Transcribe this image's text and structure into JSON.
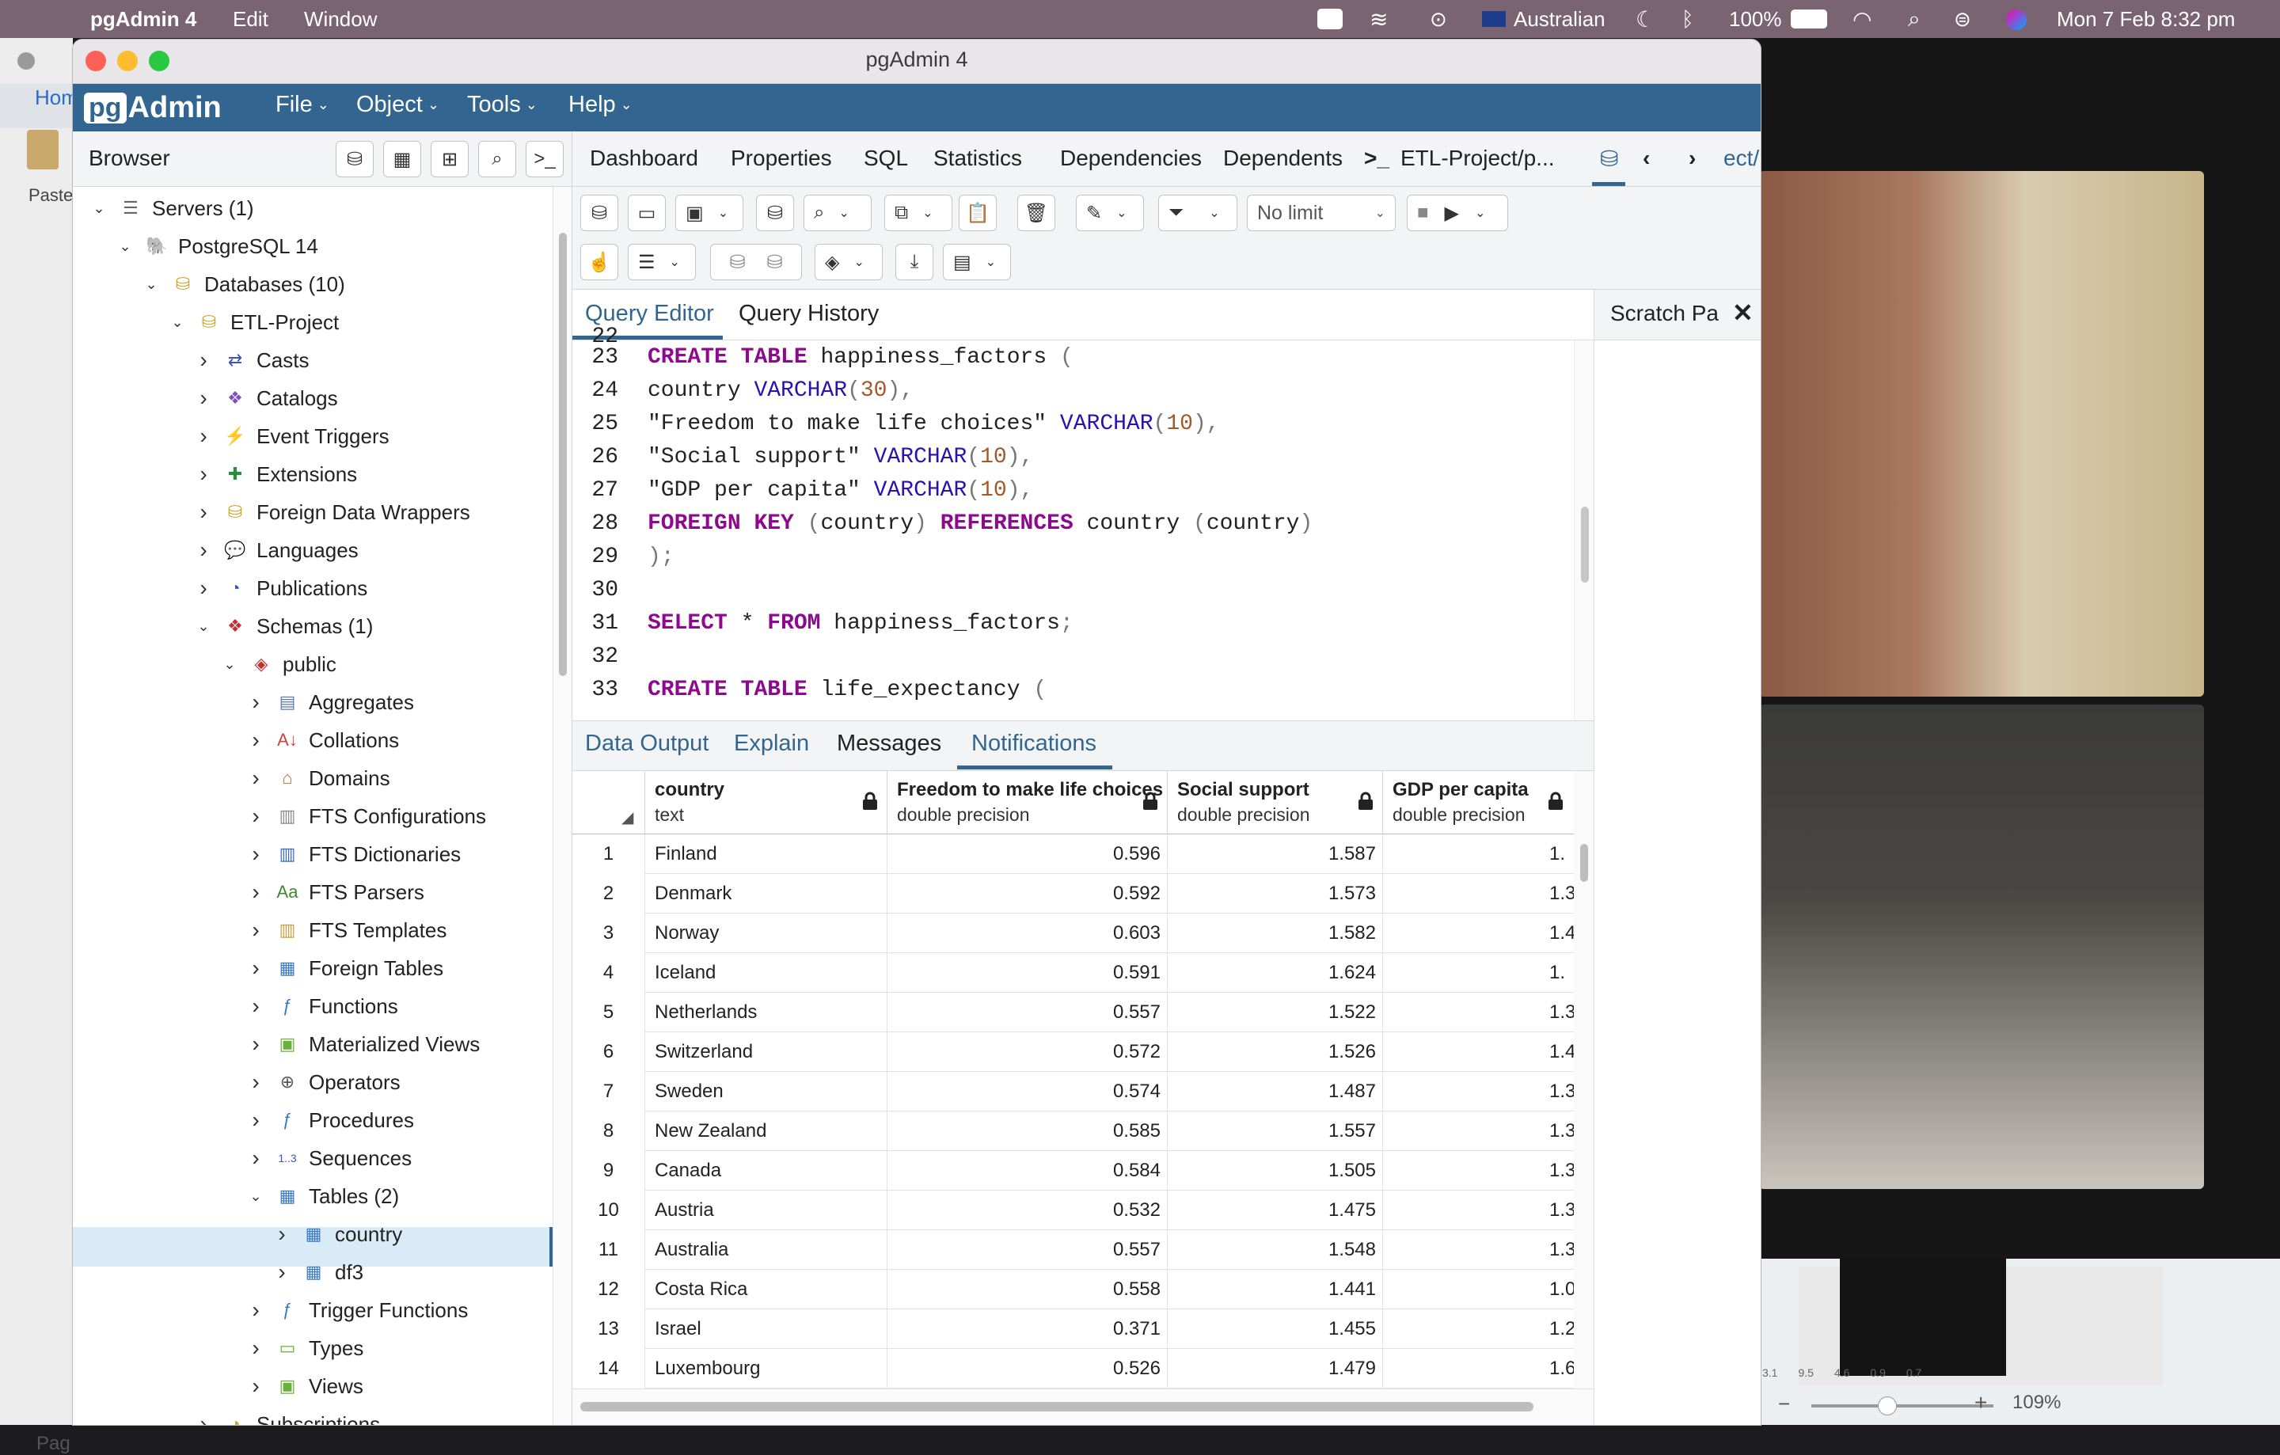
{
  "menubar": {
    "app_name": "pgAdmin 4",
    "menus": [
      "Edit",
      "Window"
    ],
    "input_source": "Australian",
    "battery": "100%",
    "datetime": "Mon 7 Feb  8:32 pm"
  },
  "background_app": {
    "tab_label": "Hom",
    "paste_label": "Paste",
    "page_label": "Pag",
    "zoom": "109%",
    "numbers": [
      "3.1",
      "9.5",
      "4.6",
      "0.9",
      "0.7"
    ]
  },
  "window": {
    "title": "pgAdmin 4"
  },
  "appbar": {
    "logo_pg": "pg",
    "logo_text": "Admin",
    "menus": [
      "File",
      "Object",
      "Tools",
      "Help"
    ]
  },
  "browser": {
    "title": "Browser",
    "tree": [
      {
        "label": "Servers (1)",
        "icon": "servers-icon",
        "level": 0,
        "expanded": true
      },
      {
        "label": "PostgreSQL 14",
        "icon": "elephant-icon",
        "level": 1,
        "expanded": true
      },
      {
        "label": "Databases (10)",
        "icon": "databases-icon",
        "level": 2,
        "expanded": true
      },
      {
        "label": "ETL-Project",
        "icon": "database-icon",
        "level": 3,
        "expanded": true
      },
      {
        "label": "Casts",
        "icon": "casts-icon",
        "level": 4,
        "expanded": false
      },
      {
        "label": "Catalogs",
        "icon": "catalogs-icon",
        "level": 4,
        "expanded": false
      },
      {
        "label": "Event Triggers",
        "icon": "event-triggers-icon",
        "level": 4,
        "expanded": false
      },
      {
        "label": "Extensions",
        "icon": "extensions-icon",
        "level": 4,
        "expanded": false
      },
      {
        "label": "Foreign Data Wrappers",
        "icon": "foreign-data-wrappers-icon",
        "level": 4,
        "expanded": false
      },
      {
        "label": "Languages",
        "icon": "languages-icon",
        "level": 4,
        "expanded": false
      },
      {
        "label": "Publications",
        "icon": "publications-icon",
        "level": 4,
        "expanded": false
      },
      {
        "label": "Schemas (1)",
        "icon": "schemas-icon",
        "level": 4,
        "expanded": true
      },
      {
        "label": "public",
        "icon": "schema-icon",
        "level": 5,
        "expanded": true
      },
      {
        "label": "Aggregates",
        "icon": "aggregates-icon",
        "level": 6,
        "expanded": false
      },
      {
        "label": "Collations",
        "icon": "collations-icon",
        "level": 6,
        "expanded": false
      },
      {
        "label": "Domains",
        "icon": "domains-icon",
        "level": 6,
        "expanded": false
      },
      {
        "label": "FTS Configurations",
        "icon": "fts-configurations-icon",
        "level": 6,
        "expanded": false
      },
      {
        "label": "FTS Dictionaries",
        "icon": "fts-dictionaries-icon",
        "level": 6,
        "expanded": false
      },
      {
        "label": "FTS Parsers",
        "icon": "fts-parsers-icon",
        "level": 6,
        "expanded": false
      },
      {
        "label": "FTS Templates",
        "icon": "fts-templates-icon",
        "level": 6,
        "expanded": false
      },
      {
        "label": "Foreign Tables",
        "icon": "foreign-tables-icon",
        "level": 6,
        "expanded": false
      },
      {
        "label": "Functions",
        "icon": "functions-icon",
        "level": 6,
        "expanded": false
      },
      {
        "label": "Materialized Views",
        "icon": "materialized-views-icon",
        "level": 6,
        "expanded": false
      },
      {
        "label": "Operators",
        "icon": "operators-icon",
        "level": 6,
        "expanded": false
      },
      {
        "label": "Procedures",
        "icon": "procedures-icon",
        "level": 6,
        "expanded": false
      },
      {
        "label": "Sequences",
        "icon": "sequences-icon",
        "level": 6,
        "expanded": false
      },
      {
        "label": "Tables (2)",
        "icon": "tables-icon",
        "level": 6,
        "expanded": true
      },
      {
        "label": "country",
        "icon": "table-icon",
        "level": 7,
        "expanded": false
      },
      {
        "label": "df3",
        "icon": "table-icon",
        "level": 7,
        "expanded": false,
        "selected": true
      },
      {
        "label": "Trigger Functions",
        "icon": "trigger-functions-icon",
        "level": 6,
        "expanded": false
      },
      {
        "label": "Types",
        "icon": "types-icon",
        "level": 6,
        "expanded": false
      },
      {
        "label": "Views",
        "icon": "views-icon",
        "level": 6,
        "expanded": false
      },
      {
        "label": "Subscriptions",
        "icon": "subscriptions-icon",
        "level": 4,
        "expanded": false
      }
    ]
  },
  "main_tabs": [
    "Dashboard",
    "Properties",
    "SQL",
    "Statistics",
    "Dependencies",
    "Dependents",
    "ETL-Project/p...",
    "ect/"
  ],
  "toolbar": {
    "limit_value": "No limit"
  },
  "query_tabs": {
    "editor": "Query Editor",
    "history": "Query History"
  },
  "scratch": {
    "label": "Scratch Pa"
  },
  "editor": {
    "partial_line": "22",
    "lines": [
      {
        "n": "23",
        "html": "CREATE TABLE happiness_factors ("
      },
      {
        "n": "24",
        "html": "country VARCHAR(30),"
      },
      {
        "n": "25",
        "html": "\"Freedom to make life choices\" VARCHAR(10),"
      },
      {
        "n": "26",
        "html": "\"Social support\" VARCHAR(10),"
      },
      {
        "n": "27",
        "html": "\"GDP per capita\" VARCHAR(10),"
      },
      {
        "n": "28",
        "html": "FOREIGN KEY (country) REFERENCES country (country)"
      },
      {
        "n": "29",
        "html": ");"
      },
      {
        "n": "30",
        "html": ""
      },
      {
        "n": "31",
        "html": "SELECT * FROM happiness_factors;"
      },
      {
        "n": "32",
        "html": ""
      },
      {
        "n": "33",
        "html": "CREATE TABLE life_expectancy ("
      }
    ]
  },
  "output_tabs": [
    "Data Output",
    "Explain",
    "Messages",
    "Notifications"
  ],
  "grid": {
    "columns": [
      {
        "name": "country",
        "type": "text"
      },
      {
        "name": "Freedom to make life choices",
        "type": "double precision"
      },
      {
        "name": "Social support",
        "type": "double precision"
      },
      {
        "name": "GDP per capita",
        "type": "double precision"
      }
    ],
    "rows": [
      {
        "n": "1",
        "country": "Finland",
        "freedom": "0.596",
        "social": "1.587",
        "gdp": "1."
      },
      {
        "n": "2",
        "country": "Denmark",
        "freedom": "0.592",
        "social": "1.573",
        "gdp": "1.3"
      },
      {
        "n": "3",
        "country": "Norway",
        "freedom": "0.603",
        "social": "1.582",
        "gdp": "1.4"
      },
      {
        "n": "4",
        "country": "Iceland",
        "freedom": "0.591",
        "social": "1.624",
        "gdp": "1."
      },
      {
        "n": "5",
        "country": "Netherlands",
        "freedom": "0.557",
        "social": "1.522",
        "gdp": "1.3"
      },
      {
        "n": "6",
        "country": "Switzerland",
        "freedom": "0.572",
        "social": "1.526",
        "gdp": "1.4"
      },
      {
        "n": "7",
        "country": "Sweden",
        "freedom": "0.574",
        "social": "1.487",
        "gdp": "1.3"
      },
      {
        "n": "8",
        "country": "New Zealand",
        "freedom": "0.585",
        "social": "1.557",
        "gdp": "1.3"
      },
      {
        "n": "9",
        "country": "Canada",
        "freedom": "0.584",
        "social": "1.505",
        "gdp": "1.3"
      },
      {
        "n": "10",
        "country": "Austria",
        "freedom": "0.532",
        "social": "1.475",
        "gdp": "1.3"
      },
      {
        "n": "11",
        "country": "Australia",
        "freedom": "0.557",
        "social": "1.548",
        "gdp": "1.3"
      },
      {
        "n": "12",
        "country": "Costa Rica",
        "freedom": "0.558",
        "social": "1.441",
        "gdp": "1.0"
      },
      {
        "n": "13",
        "country": "Israel",
        "freedom": "0.371",
        "social": "1.455",
        "gdp": "1.2"
      },
      {
        "n": "14",
        "country": "Luxembourg",
        "freedom": "0.526",
        "social": "1.479",
        "gdp": "1.6"
      }
    ]
  },
  "colors": {
    "menubar": "#7b6472",
    "appbar": "#326690",
    "keyword": "#8d0a8e",
    "type": "#2a12b0",
    "number": "#a6582a",
    "active_tab": "#326690",
    "selection": "#d9ebf7"
  }
}
